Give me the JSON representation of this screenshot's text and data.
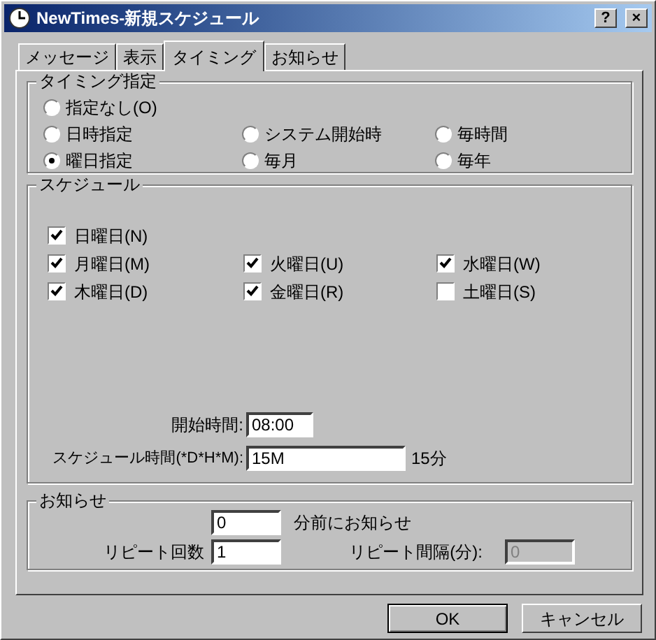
{
  "window": {
    "title": "NewTimes-新規スケジュール",
    "buttons": [
      "?",
      "×"
    ]
  },
  "tabs": [
    {
      "label": "メッセージ",
      "selected": false
    },
    {
      "label": "表示",
      "selected": false
    },
    {
      "label": "タイミング",
      "selected": true
    },
    {
      "label": "お知らせ",
      "selected": false
    }
  ],
  "timing": {
    "title": "タイミング指定",
    "options": [
      {
        "label": "指定なし(O)",
        "selected": false
      },
      {
        "label": "日時指定",
        "selected": false
      },
      {
        "label": "システム開始時",
        "selected": false
      },
      {
        "label": "毎時間",
        "selected": false
      },
      {
        "label": "曜日指定",
        "selected": true
      },
      {
        "label": "毎月",
        "selected": false
      },
      {
        "label": "毎年",
        "selected": false
      }
    ]
  },
  "schedule": {
    "title": "スケジュール",
    "days": [
      {
        "label": "日曜日(N)",
        "checked": true
      },
      {
        "label": "月曜日(M)",
        "checked": true
      },
      {
        "label": "火曜日(U)",
        "checked": true
      },
      {
        "label": "水曜日(W)",
        "checked": true
      },
      {
        "label": "木曜日(D)",
        "checked": true
      },
      {
        "label": "金曜日(R)",
        "checked": true
      },
      {
        "label": "土曜日(S)",
        "checked": false
      }
    ],
    "start_time": {
      "label": "開始時間:",
      "value": "08:00"
    },
    "schedule_time": {
      "label": "スケジュール時間(*D*H*M):",
      "value": "15M",
      "note": "15分"
    }
  },
  "notice": {
    "title": "お知らせ",
    "before": {
      "value": "0",
      "label": "分前にお知らせ"
    },
    "repeat_count": {
      "label": "リピート回数",
      "value": "1"
    },
    "repeat_interval": {
      "label": "リピート間隔(分):",
      "value": "0",
      "disabled": true
    }
  },
  "buttons": [
    "OK",
    "キャンセル"
  ]
}
